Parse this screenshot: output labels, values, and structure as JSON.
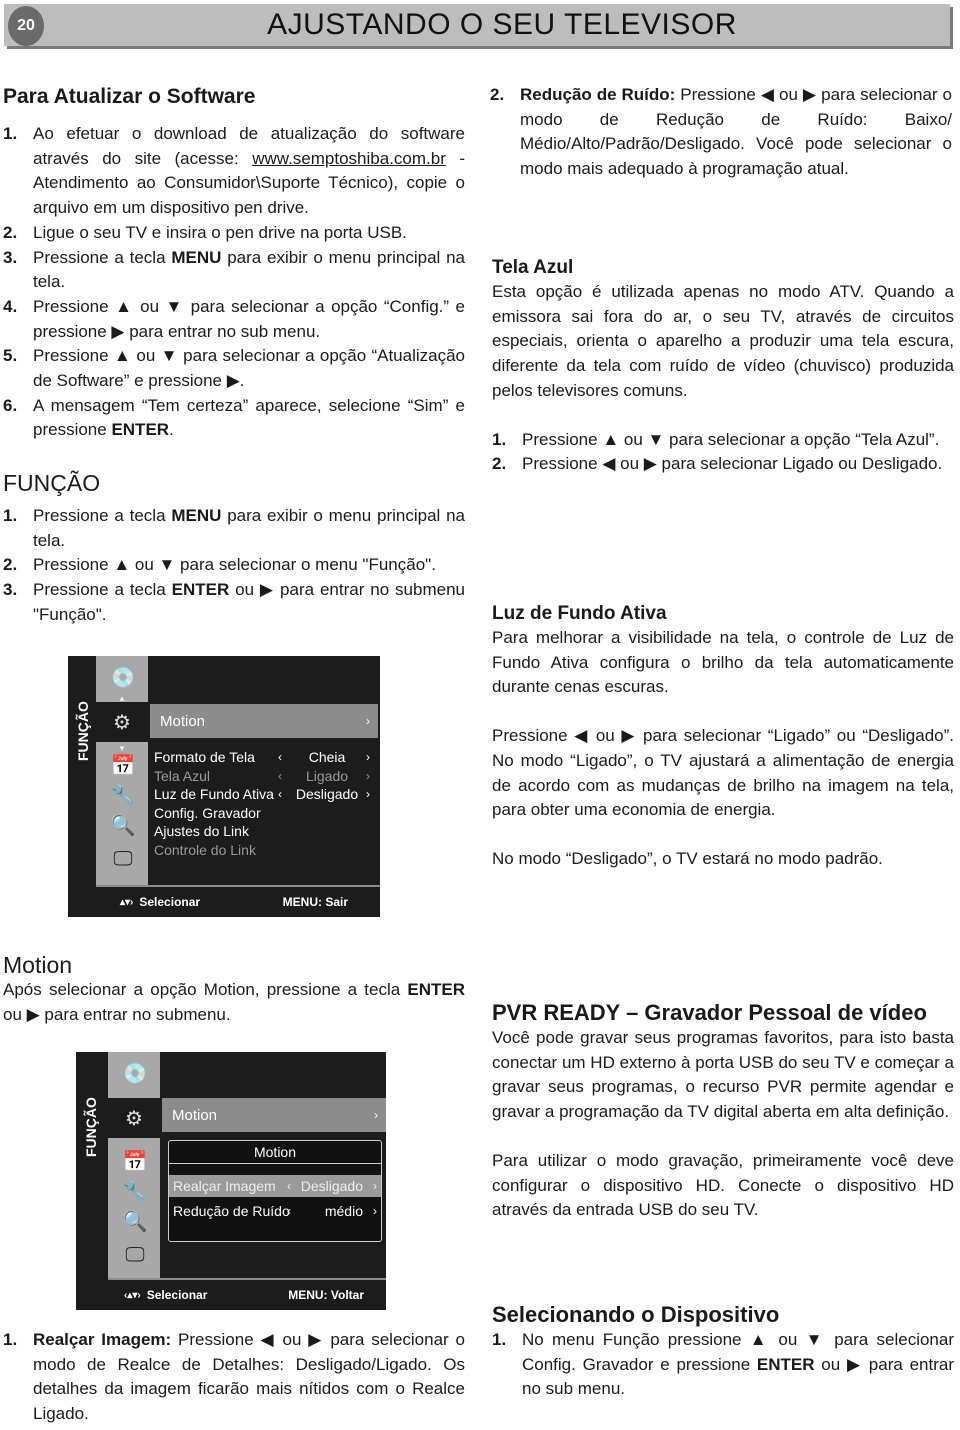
{
  "header": {
    "page_number": "20",
    "title": "AJUSTANDO O SEU TELEVISOR"
  },
  "left": {
    "update": {
      "title": "Para Atualizar o Software",
      "steps": [
        {
          "n": "1.",
          "html": "Ao efetuar o download de atualização do software através do site (acesse: <span class=\"u\">www.semptoshiba.com.br</span> - Atendimento ao Consumidor\\Suporte Técnico), copie o arquivo em um dispositivo pen drive."
        },
        {
          "n": "2.",
          "html": "Ligue o seu TV e insira o pen drive na porta USB."
        },
        {
          "n": "3.",
          "html": "Pressione a tecla <b>MENU</b> para exibir o menu principal na tela."
        },
        {
          "n": "4.",
          "html": "Pressione ▲ ou ▼ para selecionar a opção “Config.” e pressione ▶ para entrar no sub menu."
        },
        {
          "n": "5.",
          "html": "Pressione ▲ ou ▼ para selecionar a opção “Atualização de Software” e pressione ▶."
        },
        {
          "n": "6.",
          "html": "A mensagem “Tem certeza” aparece, selecione “Sim” e pressione <b>ENTER</b>."
        }
      ]
    },
    "funcao": {
      "title": "FUNÇÃO",
      "steps": [
        {
          "n": "1.",
          "html": "Pressione a tecla <b>MENU</b> para exibir o menu principal na tela."
        },
        {
          "n": "2.",
          "html": "Pressione ▲ ou ▼ para selecionar o menu \"Função\"."
        },
        {
          "n": "3.",
          "html": "Pressione a tecla <b>ENTER</b> ou ▶ para entrar no submenu \"Função\"."
        }
      ]
    },
    "menu1": {
      "side_label": "FUNÇÃO",
      "icons": [
        "media-disc-icon",
        "settings-gears-icon",
        "calendar-clock-icon",
        "tools-icon",
        "search-magnifier-icon",
        "monitor-icon"
      ],
      "selected": "Motion",
      "rows": [
        {
          "label": "Formato de Tela",
          "value": "Cheia",
          "dim": false
        },
        {
          "label": "Tela Azul",
          "value": "Ligado",
          "dim": true
        },
        {
          "label": "Luz de Fundo Ativa",
          "value": "Desligado",
          "dim": false
        },
        {
          "label": "Config. Gravador",
          "value": "",
          "dim": false
        },
        {
          "label": "Ajustes do Link",
          "value": "",
          "dim": false
        },
        {
          "label": "Controle do Link",
          "value": "",
          "dim": true
        }
      ],
      "footer_nav": "Selecionar",
      "footer_exit": "MENU: Sair"
    },
    "motion": {
      "title": "Motion",
      "text": "Após selecionar a opção Motion, pressione a tecla <b>ENTER</b> ou ▶ para entrar no submenu."
    },
    "menu2": {
      "side_label": "FUNÇÃO",
      "selected": "Motion",
      "sub_title": "Motion",
      "rows": [
        {
          "label": "Realçar Imagem",
          "value": "Desligado",
          "highlight": true
        },
        {
          "label": "Redução de Ruído",
          "value": "médio",
          "highlight": false
        }
      ],
      "footer_nav": "Selecionar",
      "footer_exit": "MENU: Voltar"
    },
    "realcar": {
      "n": "1.",
      "html": "<b>Realçar Imagem:</b> Pressione ◀ ou ▶ para selecionar o modo de Realce de Detalhes: Desligado/Ligado. Os detalhes da imagem ficarão mais nítidos com o Realce Ligado."
    }
  },
  "right": {
    "reducao": {
      "n": "2.",
      "html": "<b>Redução de Ruído:</b> Pressione ◀ ou ▶ para selecionar o modo de Redução de Ruído: Baixo/ Médio/Alto/Padrão/Desligado. Você pode selecionar o modo mais adequado à programação atual."
    },
    "tela_azul": {
      "title": "Tela Azul",
      "text": "Esta opção é utilizada apenas no modo ATV. Quando a emissora sai fora do ar, o seu TV, através de circuitos especiais, orienta o aparelho a produzir uma tela escura, diferente da tela com ruído de vídeo (chuvisco) produzida pelos televisores comuns.",
      "steps": [
        {
          "n": "1.",
          "html": "Pressione ▲ ou ▼ para selecionar a opção “Tela Azul”."
        },
        {
          "n": "2.",
          "html": "Pressione ◀ ou ▶ para selecionar Ligado ou Desligado."
        }
      ]
    },
    "luz": {
      "title": "Luz de Fundo Ativa",
      "text": "Para melhorar a visibilidade na tela, o controle de Luz de Fundo Ativa configura o brilho da tela automaticamente durante cenas escuras.",
      "text2": "Pressione ◀ ou ▶ para selecionar “Ligado” ou “Desligado”. No modo “Ligado”, o TV ajustará a alimentação de energia de acordo com as mudanças de brilho na imagem na tela, para obter uma economia de energia.",
      "text3": "No modo “Desligado”, o TV estará no modo padrão."
    },
    "pvr": {
      "title": "PVR READY – Gravador Pessoal de vídeo",
      "text": "Você pode gravar seus programas favoritos, para isto basta conectar um HD externo à porta USB do seu TV e começar a gravar seus programas, o recurso PVR permite agendar e gravar a programação da TV digital aberta em alta definição.",
      "text2": "Para utilizar o modo gravação, primeiramente você deve configurar o dispositivo HD. Conecte o dispositivo HD através da entrada USB do seu TV."
    },
    "selecionando": {
      "title": "Selecionando  o Dispositivo",
      "steps": [
        {
          "n": "1.",
          "html": "No menu Função pressione ▲ ou ▼ para selecionar Config. Gravador e pressione <b>ENTER</b> ou ▶ para entrar no sub menu."
        }
      ]
    }
  }
}
